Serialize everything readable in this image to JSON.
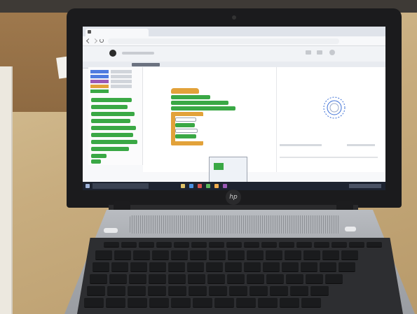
{
  "scene": {
    "description_colors": {
      "desk": "#c8ad7f",
      "laptop_lid": "#1b1b1d",
      "screen_bg": "#f7f8fa",
      "block_green": "#3aa845",
      "block_orange": "#e2a23a",
      "taskbar": "#1d2330"
    }
  },
  "laptop": {
    "brand_logo_icon": "hp-logo",
    "logo_text": "hp"
  },
  "screen": {
    "tab_icon": "app-tab-icon",
    "nav_icons": [
      "back-arrow-icon",
      "forward-arrow-icon",
      "reload-icon"
    ],
    "app_icons": [
      "app-logo-icon",
      "share-icon",
      "settings-icon"
    ]
  }
}
